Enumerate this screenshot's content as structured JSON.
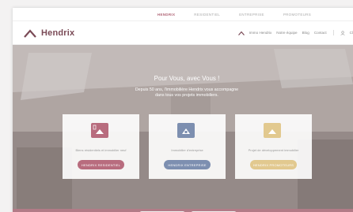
{
  "topbar": {
    "items": [
      "HENDRIX",
      "RESIDENTIEL",
      "ENTREPRISE",
      "PROMOTEURS"
    ]
  },
  "header": {
    "logo_text": "Hendrix",
    "nav": [
      "Immo Hendrix",
      "Notre équipe",
      "Blog",
      "Contact"
    ],
    "nav_extra": "Cl"
  },
  "hero": {
    "title": "Pour Vous, avec Vous !",
    "subtitle_line1": "Depuis 50 ans, l'immobilière Hendrix vous accompagne",
    "subtitle_line2": "dans tous vos projets immobiliers."
  },
  "cards": [
    {
      "desc": "Biens résidentiels et immobilier neuf",
      "button": "HENDRIX RESIDENTIEL",
      "color": "#b86c7e"
    },
    {
      "desc": "Immobilier d'entreprise",
      "button": "HENDRIX ENTREPRISE",
      "color": "#7d8fb0"
    },
    {
      "desc": "Projet de développement immobilier",
      "button": "HENDRIX PROMOTEURS",
      "color": "#e2c98f"
    }
  ],
  "colors": {
    "brand": "#7a4a56",
    "active_nav": "#b06576"
  }
}
